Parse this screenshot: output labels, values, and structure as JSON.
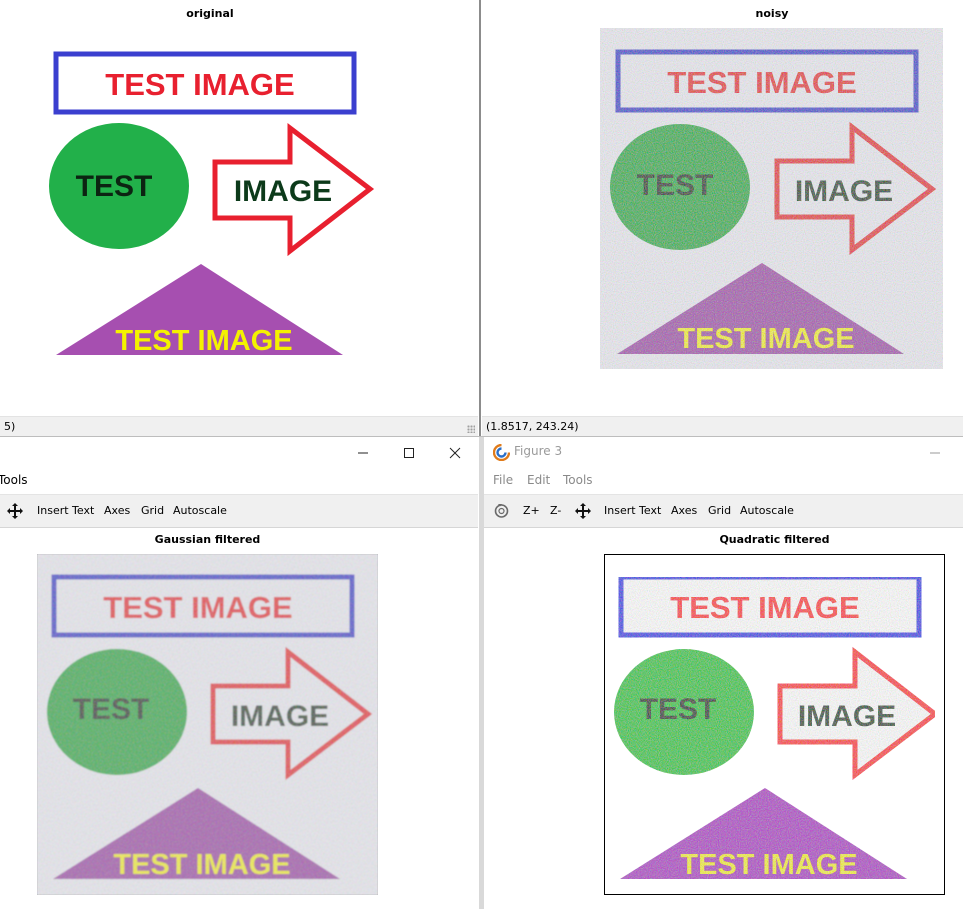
{
  "top_left": {
    "plot_title": "original",
    "status_text": "5)"
  },
  "top_right": {
    "plot_title": "noisy",
    "status_text": "(1.8517, 243.24)"
  },
  "bottom_left": {
    "menu": [
      "Tools"
    ],
    "toolbar": {
      "insert_text": "Insert Text",
      "axes": "Axes",
      "grid": "Grid",
      "autoscale": "Autoscale"
    },
    "plot_title": "Gaussian filtered"
  },
  "bottom_right": {
    "window_title": "Figure 3",
    "menu": [
      "File",
      "Edit",
      "Tools"
    ],
    "toolbar": {
      "zoom_in": "Z+",
      "zoom_out": "Z-",
      "insert_text": "Insert Text",
      "axes": "Axes",
      "grid": "Grid",
      "autoscale": "Autoscale"
    },
    "plot_title": "Quadratic filtered"
  },
  "test_image": {
    "banner_text": "TEST IMAGE",
    "circle_text": "TEST",
    "arrow_text": "IMAGE",
    "triangle_text": "TEST IMAGE"
  },
  "colors": {
    "blue": "#3b3fcf",
    "red": "#e8202f",
    "green": "#22b04a",
    "purple": "#a64fb0",
    "yellow": "#f4f200",
    "dark_green": "#0c3a1a"
  },
  "icons": {
    "pan": "four-arrows",
    "rotate": "rotate-3d",
    "app": "octave-logo",
    "minimize": "minimize",
    "maximize": "maximize",
    "close": "close"
  }
}
